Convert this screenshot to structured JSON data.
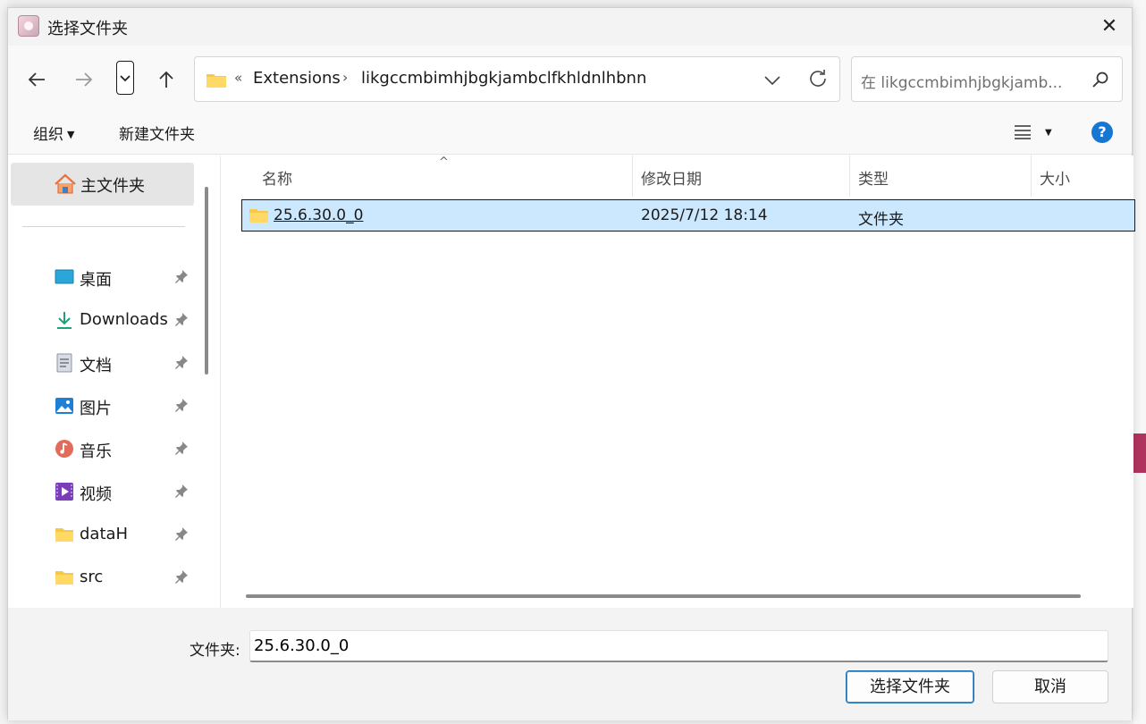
{
  "window": {
    "title": "选择文件夹",
    "close_label": "✕"
  },
  "address": {
    "overflow_glyph": "«",
    "crumbs": [
      "Extensions",
      "likgccmbimhjbgkjambclfkhldnlhbnn"
    ],
    "separator": "›"
  },
  "search": {
    "placeholder": "在 likgccmbimhjbgkjamb..."
  },
  "toolbar": {
    "organize_label": "组织",
    "new_folder_label": "新建文件夹",
    "help_label": "?"
  },
  "sidebar": {
    "home_label": "主文件夹",
    "items": [
      {
        "label": "桌面",
        "icon": "desktop-icon"
      },
      {
        "label": "Downloads",
        "icon": "downloads-icon"
      },
      {
        "label": "文档",
        "icon": "documents-icon"
      },
      {
        "label": "图片",
        "icon": "pictures-icon"
      },
      {
        "label": "音乐",
        "icon": "music-icon"
      },
      {
        "label": "视频",
        "icon": "videos-icon"
      },
      {
        "label": "dataH",
        "icon": "folder-icon"
      },
      {
        "label": "src",
        "icon": "folder-icon"
      }
    ]
  },
  "table": {
    "columns": [
      "名称",
      "修改日期",
      "类型",
      "大小"
    ],
    "rows": [
      {
        "name": "25.6.30.0_0",
        "modified": "2025/7/12 18:14",
        "type": "文件夹",
        "size": ""
      }
    ]
  },
  "footer": {
    "folder_label": "文件夹:",
    "folder_value": "25.6.30.0_0",
    "select_label": "选择文件夹",
    "cancel_label": "取消"
  },
  "colors": {
    "accent": "#1677d2",
    "selection": "#cce8ff",
    "folder": "#f7c948"
  }
}
